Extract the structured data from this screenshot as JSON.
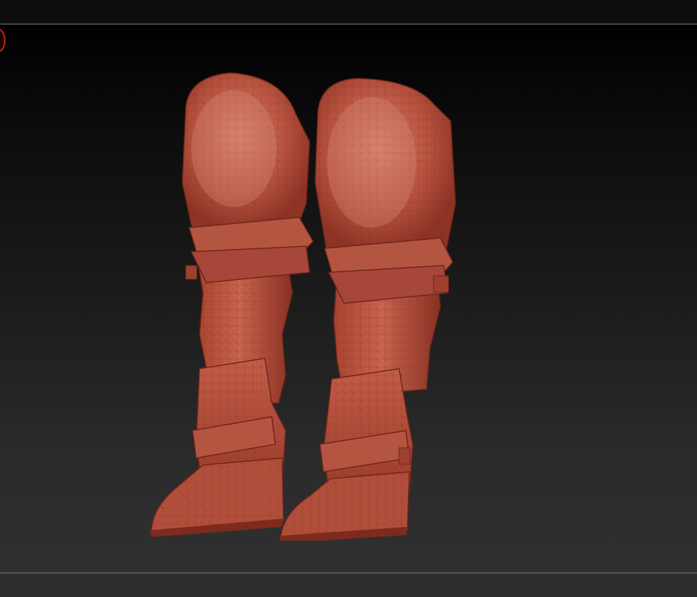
{
  "canvas": {
    "background": "#1e1e1e",
    "material_color": "#b84a3a"
  },
  "model": {
    "name": "armored-boots-mesh",
    "items": [
      "right-boot",
      "left-boot"
    ]
  },
  "icons": {
    "corner_indicator": "red-circle-icon"
  }
}
